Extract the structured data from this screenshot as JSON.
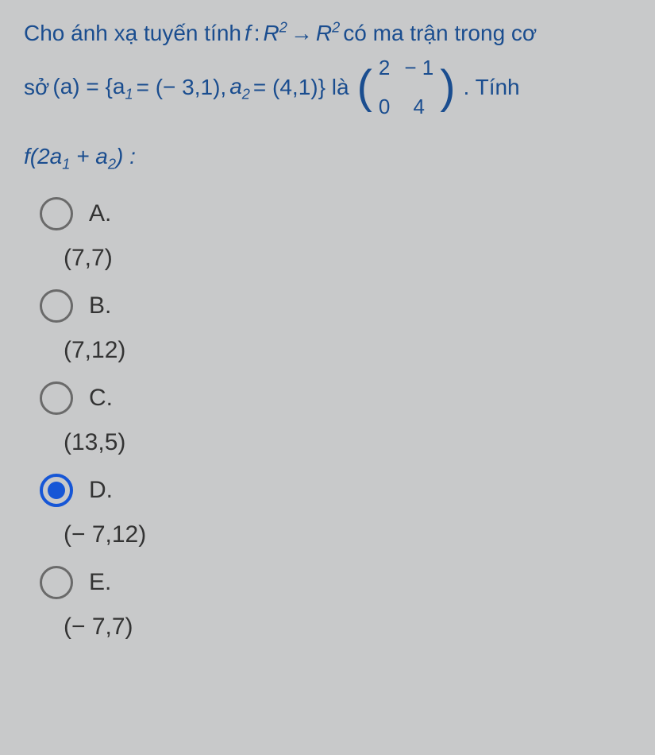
{
  "question": {
    "line1_pre": "Cho ánh xạ tuyến tính ",
    "f": "f",
    "colon": " : ",
    "R2_1": "R",
    "arrow": " → ",
    "R2_2": "R",
    "line1_post": " có ma trận trong cơ",
    "line2_pre": "sở ",
    "basis": "(a) = {a",
    "eq1": " = (− 3,1), ",
    "a2": "a",
    "eq2": " = (4,1)} là ",
    "matrix": {
      "a": "2",
      "b": "− 1",
      "c": "0",
      "d": "4"
    },
    "line2_post": " . Tính",
    "compute": "f(2a",
    "compute_mid": " + a",
    "compute_post": ") :"
  },
  "options": [
    {
      "letter": "A.",
      "value": "(7,7)",
      "selected": false
    },
    {
      "letter": "B.",
      "value": "(7,12)",
      "selected": false
    },
    {
      "letter": "C.",
      "value": "(13,5)",
      "selected": false
    },
    {
      "letter": "D.",
      "value": "(− 7,12)",
      "selected": true
    },
    {
      "letter": "E.",
      "value": "(− 7,7)",
      "selected": false
    }
  ]
}
